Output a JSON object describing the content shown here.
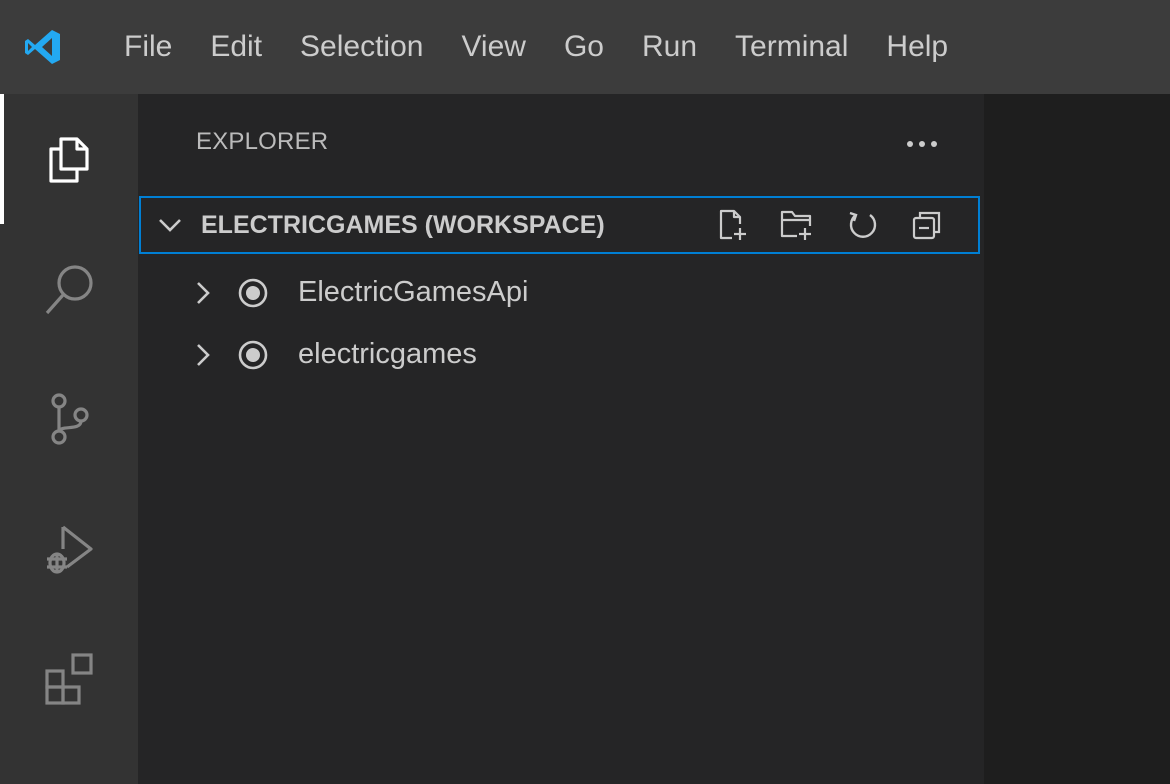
{
  "menu": {
    "items": [
      "File",
      "Edit",
      "Selection",
      "View",
      "Go",
      "Run",
      "Terminal",
      "Help"
    ]
  },
  "activity_bar": {
    "icons": [
      "explorer-icon",
      "search-icon",
      "source-control-icon",
      "run-debug-icon",
      "extensions-icon"
    ],
    "active": "explorer-icon"
  },
  "explorer": {
    "title": "EXPLORER",
    "more_label": "···",
    "workspace": {
      "label": "ELECTRICGAMES (WORKSPACE)",
      "actions": [
        "new-file-icon",
        "new-folder-icon",
        "refresh-icon",
        "collapse-all-icon"
      ]
    },
    "folders": [
      {
        "label": "ElectricGamesApi",
        "icon": "root-folder-icon"
      },
      {
        "label": "electricgames",
        "icon": "root-folder-icon"
      }
    ]
  },
  "colors": {
    "titlebar": "#3c3c3c",
    "activitybar": "#333333",
    "sidebar": "#252526",
    "editor": "#1e1e1e",
    "focus_border": "#007fd4",
    "vscode_blue": "#23a9f2"
  }
}
